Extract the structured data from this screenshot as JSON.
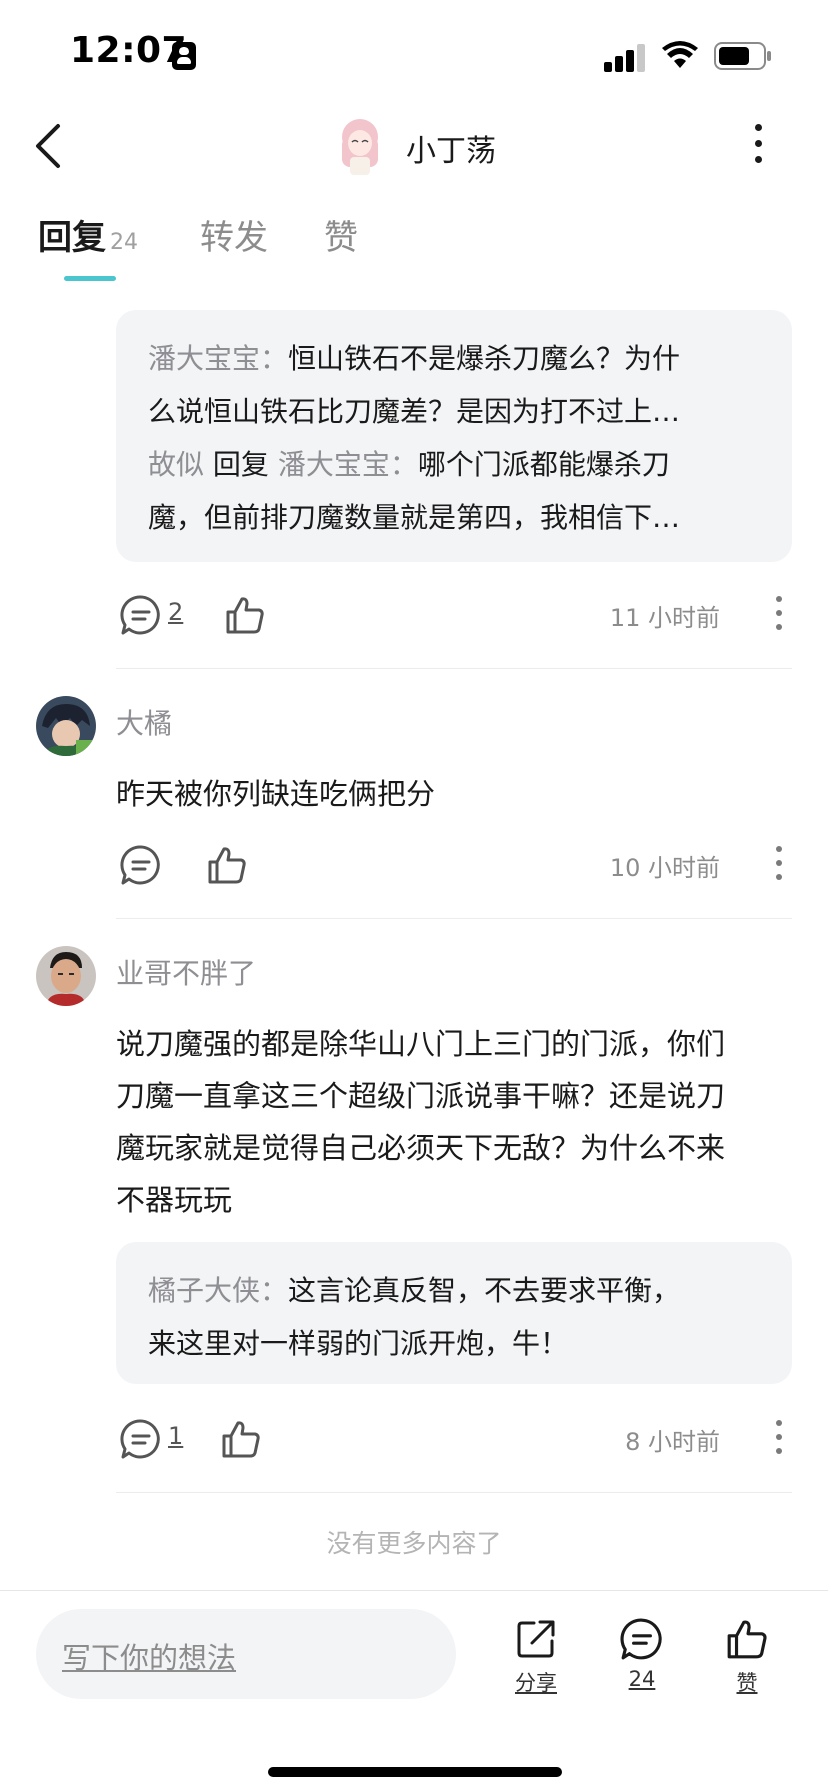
{
  "status_bar": {
    "time": "12:07"
  },
  "header": {
    "title": "小丁荡"
  },
  "tabs": [
    {
      "label": "回复",
      "count": "24"
    },
    {
      "label": "转发"
    },
    {
      "label": "赞"
    }
  ],
  "comments": [
    {
      "quotes": [
        {
          "user": "潘大宝宝",
          "sep": "：",
          "text_line1": "恒山铁石不是爆杀刀魔么？为什",
          "text_line2": "么说恒山铁石比刀魔差？是因为打不过上…"
        },
        {
          "user": "故似",
          "reply_word": "回复",
          "reply_to": "潘大宝宝",
          "sep": "：",
          "text_line1": "哪个门派都能爆杀刀",
          "text_line2": "魔，但前排刀魔数量就是第四，我相信下…"
        }
      ],
      "reply_count": "2",
      "time": "11 小时前"
    },
    {
      "author": "大橘",
      "text": "昨天被你列缺连吃俩把分",
      "time": "10 小时前"
    },
    {
      "author": "业哥不胖了",
      "text_lines": [
        "说刀魔强的都是除华山八门上三门的门派，你们",
        "刀魔一直拿这三个超级门派说事干嘛？还是说刀",
        "魔玩家就是觉得自己必须天下无敌？为什么不来",
        "不器玩玩"
      ],
      "quote": {
        "user": "橘子大侠",
        "sep": "：",
        "text_line1": "这言论真反智，不去要求平衡，",
        "text_line2": "来这里对一样弱的门派开炮，牛！"
      },
      "reply_count": "1",
      "time": "8 小时前"
    }
  ],
  "no_more": "没有更多内容了",
  "bottom_bar": {
    "input_placeholder": "写下你的想法",
    "share_label": "分享",
    "comment_count": "24",
    "like_label": "赞"
  },
  "colors": {
    "accent": "#4bc6cf",
    "quote_bg": "#f3f4f6",
    "username": "#8e8e93"
  }
}
